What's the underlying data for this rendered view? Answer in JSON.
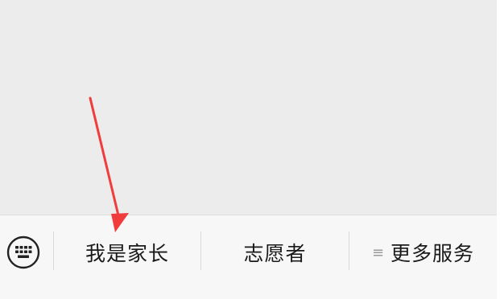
{
  "menu": {
    "keyboard_icon": "keyboard-icon",
    "items": [
      {
        "label": "我是家长"
      },
      {
        "label": "志愿者"
      },
      {
        "label": "更多服务",
        "icon": "hamburger-icon",
        "icon_glyph": "≡"
      }
    ]
  },
  "annotation": {
    "color": "#f03c3c"
  }
}
